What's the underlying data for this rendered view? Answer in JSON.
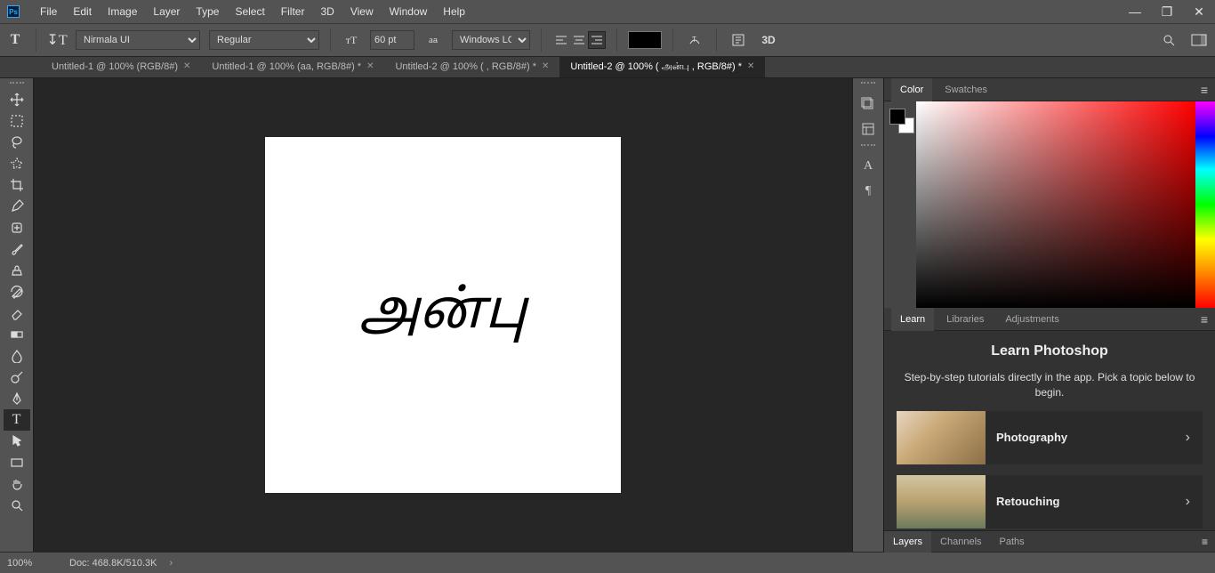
{
  "menu": {
    "items": [
      "File",
      "Edit",
      "Image",
      "Layer",
      "Type",
      "Select",
      "Filter",
      "3D",
      "View",
      "Window",
      "Help"
    ]
  },
  "window_controls": {
    "minimize": "—",
    "maximize": "❐",
    "close": "✕"
  },
  "options": {
    "font_family": "Nirmala UI",
    "font_style": "Regular",
    "font_size": "60 pt",
    "aa_mode": "Windows LCD",
    "text_align": "right",
    "color": "#000000",
    "threeD": "3D"
  },
  "tabs": [
    {
      "label": "Untitled-1 @ 100% (RGB/8#)",
      "active": false
    },
    {
      "label": "Untitled-1 @ 100% (aa, RGB/8#) *",
      "active": false
    },
    {
      "label": "Untitled-2 @ 100% (    , RGB/8#) *",
      "active": false
    },
    {
      "label": "Untitled-2 @ 100% (  அன்பு , RGB/8#) *",
      "active": true
    }
  ],
  "canvas": {
    "text": "அன்பு"
  },
  "panels": {
    "color_tabs": [
      "Color",
      "Swatches"
    ],
    "color_active": "Color",
    "learn_tabs": [
      "Learn",
      "Libraries",
      "Adjustments"
    ],
    "learn_active": "Learn",
    "learn_heading": "Learn Photoshop",
    "learn_sub": "Step-by-step tutorials directly in the app. Pick a topic below to begin.",
    "learn_cards": [
      {
        "label": "Photography",
        "thumb": "linear-gradient(135deg,#e8d5c0 0%,#c9a876 40%,#8b6f47 100%)"
      },
      {
        "label": "Retouching",
        "thumb": "linear-gradient(180deg,#d4c5a0 0%,#b8a270 50%,#6b7a5c 100%)"
      }
    ],
    "layers_tabs": [
      "Layers",
      "Channels",
      "Paths"
    ],
    "layers_active": "Layers"
  },
  "status": {
    "zoom": "100%",
    "doc": "Doc: 468.8K/510.3K"
  }
}
